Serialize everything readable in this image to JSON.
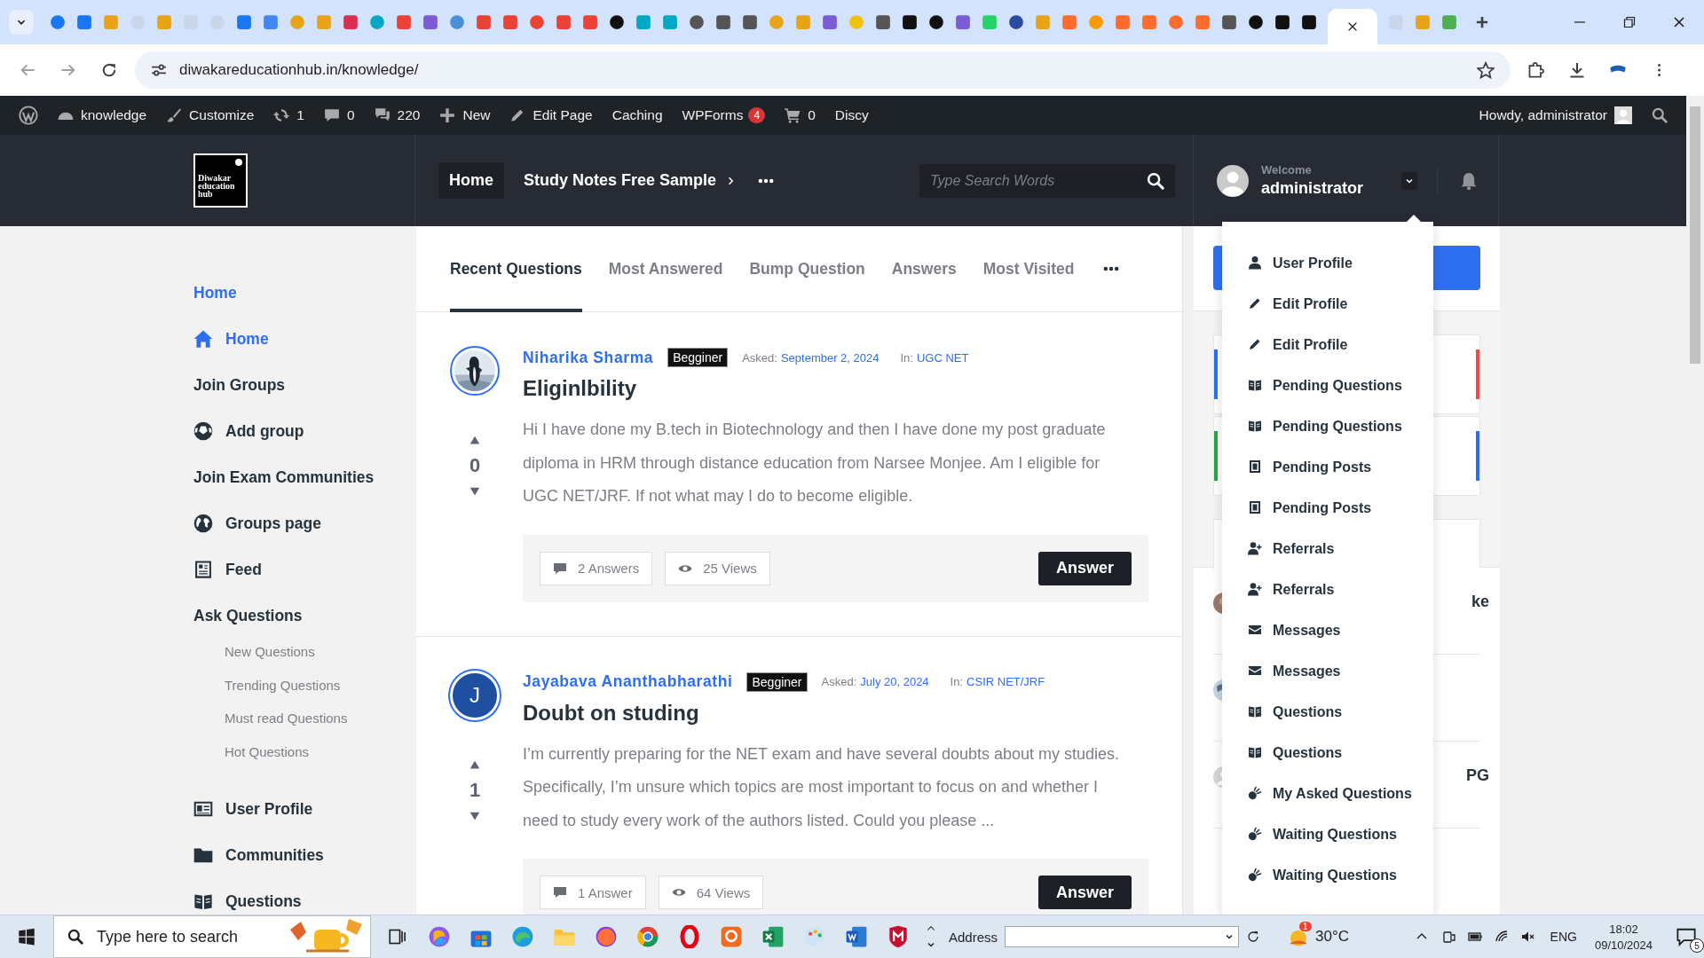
{
  "browser": {
    "url": "diwakareducationhub.in/knowledge/"
  },
  "admin_bar": {
    "items": [
      {
        "label": "knowledge"
      },
      {
        "label": "Customize"
      },
      {
        "label": "1"
      },
      {
        "label": "0"
      },
      {
        "label": "220"
      },
      {
        "label": "New"
      },
      {
        "label": "Edit Page"
      },
      {
        "label": "Caching"
      },
      {
        "label": "WPForms",
        "badge": "4"
      },
      {
        "label": "0"
      },
      {
        "label": "Discy"
      }
    ],
    "greeting": "Howdy, administrator"
  },
  "header": {
    "logo_text": "Diwakar education hub",
    "nav": [
      {
        "label": "Home",
        "selected": true,
        "submenu": false
      },
      {
        "label": "Study Notes Free Sample",
        "selected": false,
        "submenu": true
      }
    ],
    "search_placeholder": "Type Search Words",
    "user": {
      "welcome": "Welcome",
      "name": "administrator",
      "menu_open": true
    }
  },
  "sidebar": {
    "items": [
      {
        "label": "Home",
        "selected": true
      },
      {
        "label": "Home",
        "selected": true
      },
      {
        "label": "Join Groups",
        "selected": false
      },
      {
        "label": "Add group",
        "selected": false
      },
      {
        "label": "Join Exam Communities",
        "selected": false
      },
      {
        "label": "Groups page",
        "selected": false
      },
      {
        "label": "Feed",
        "selected": false
      },
      {
        "label": "Ask Questions",
        "selected": false,
        "children": [
          {
            "label": "New Questions",
            "selected": false
          },
          {
            "label": "Trending Questions",
            "selected": false
          },
          {
            "label": "Must read Questions",
            "selected": false
          },
          {
            "label": "Hot Questions",
            "selected": false
          }
        ]
      },
      {
        "label": "User Profile",
        "selected": false
      },
      {
        "label": "Communities",
        "selected": false
      },
      {
        "label": "Questions",
        "selected": false
      }
    ]
  },
  "tabs": [
    {
      "label": "Recent Questions",
      "selected": true
    },
    {
      "label": "Most Answered",
      "selected": false
    },
    {
      "label": "Bump Question",
      "selected": false
    },
    {
      "label": "Answers",
      "selected": false
    },
    {
      "label": "Most Visited",
      "selected": false
    }
  ],
  "questions": [
    {
      "author": "Niharika Sharma",
      "badge": "Begginer",
      "asked_label": "Asked:",
      "date": "September 2, 2024",
      "in_label": "In:",
      "category": "UGC NET",
      "title": "Eliginlbility",
      "votes": "0",
      "body": "Hi  I have done my B.tech in Biotechnology and then I have done my post graduate diploma in HRM through distance education from Narsee Monjee. Am I eligible for UGC NET/JRF. If not what may I do to become eligible.",
      "answers": "2 Answers",
      "views": "25 Views",
      "button": "Answer"
    },
    {
      "avatar": {
        "kind": "letter",
        "letter": "J"
      },
      "author": "Jayabava Ananthabharathi",
      "badge": "Begginer",
      "asked_label": "Asked:",
      "date": "July 20, 2024",
      "in_label": "In:",
      "category": "CSIR NET/JRF",
      "title": "Doubt on studing",
      "votes": "1",
      "body": "I’m currently preparing for the NET exam and have several doubts about my studies. Specifically, I’m unsure which topics are most important to focus on and whether I need to study every work of the authors listed. Could you please ...",
      "answers": "1 Answer",
      "views": "64 Views",
      "button": "Answer"
    }
  ],
  "user_menu": [
    {
      "label": "User Profile"
    },
    {
      "label": "Edit Profile"
    },
    {
      "label": "Edit Profile"
    },
    {
      "label": "Pending Questions"
    },
    {
      "label": "Pending Questions"
    },
    {
      "label": "Pending Posts"
    },
    {
      "label": "Pending Posts"
    },
    {
      "label": "Referrals"
    },
    {
      "label": "Referrals"
    },
    {
      "label": "Messages"
    },
    {
      "label": "Messages"
    },
    {
      "label": "Questions"
    },
    {
      "label": "Questions"
    },
    {
      "label": "My Asked Questions"
    },
    {
      "label": "Waiting Questions"
    },
    {
      "label": "Waiting Questions"
    }
  ],
  "right_sidebar": {
    "stats": [
      {
        "color": "#2e6ff2"
      },
      {
        "color": "#f04a4a"
      },
      {
        "color": "#27a844"
      },
      {
        "color": "#2e6ff2"
      }
    ],
    "posts": [
      {
        "text": "ke"
      },
      {
        "kind": "globe"
      },
      {
        "kind": "default",
        "text": "PG"
      }
    ]
  },
  "taskbar": {
    "search_placeholder": "Type here to search",
    "address_label": "Address",
    "weather": {
      "temp": "30°C",
      "alert": "1"
    },
    "language": "ENG",
    "time": "18:02",
    "date": "09/10/2024",
    "notifications": "5"
  }
}
